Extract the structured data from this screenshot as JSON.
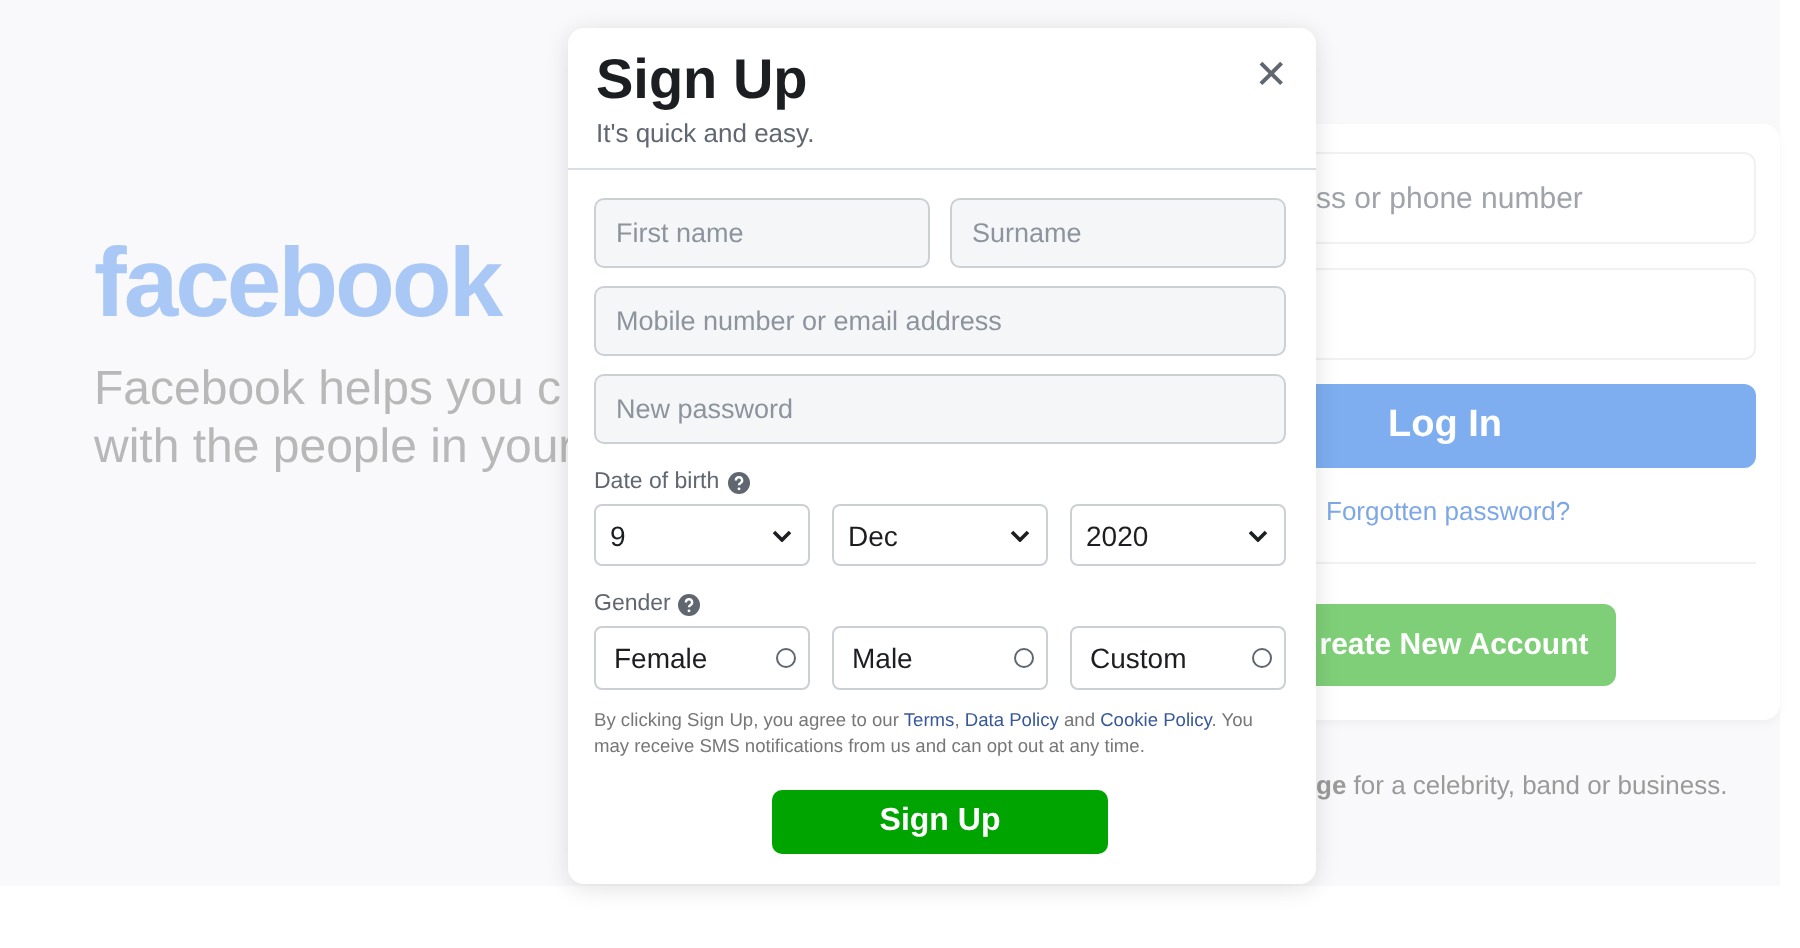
{
  "background": {
    "logo": "facebook",
    "tagline_lines": [
      "Facebook helps you c",
      "with the people in your"
    ],
    "login": {
      "email_placeholder": "ss or phone number",
      "login_button": "Log In",
      "forgot_link": "Forgotten password?",
      "create_button": "reate New Account"
    },
    "page_note": "**ge** for a celebrity, band or business."
  },
  "dialog": {
    "title": "Sign Up",
    "subtitle": "It's quick and easy.",
    "close": "✕",
    "name_fields": [
      {
        "placeholder": "First name"
      },
      {
        "placeholder": "Surname"
      }
    ],
    "contact_field": {
      "placeholder": "Mobile number or email address"
    },
    "password_field": {
      "placeholder": "New password"
    },
    "dob_label": "Date of birth",
    "dob": [
      {
        "value": "9"
      },
      {
        "value": "Dec"
      },
      {
        "value": "2020"
      }
    ],
    "gender_label": "Gender",
    "genders": [
      {
        "label": "Female",
        "selected": false
      },
      {
        "label": "Male",
        "selected": false
      },
      {
        "label": "Custom",
        "selected": false
      }
    ],
    "terms": "By clicking Sign Up, you agree to our ",
    "terms_links": [
      "Terms",
      "Data Policy",
      "Cookie Policy"
    ],
    "terms_joins": [
      ", ",
      " and "
    ],
    "terms_end": ". You may receive SMS notifications from us and can opt out at any time.",
    "submit": "Sign Up"
  }
}
